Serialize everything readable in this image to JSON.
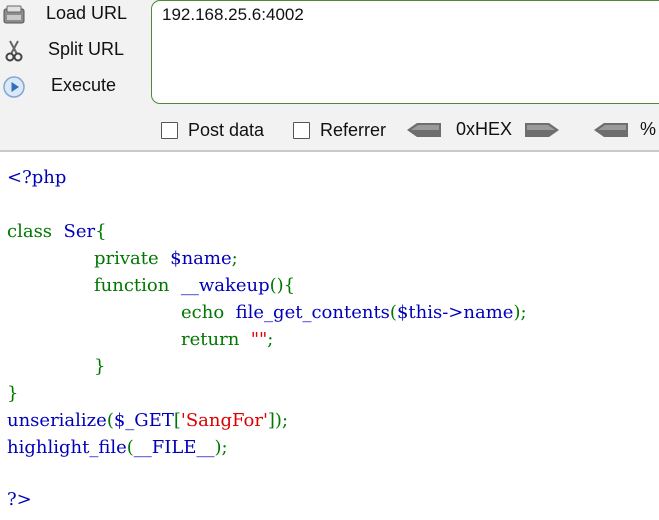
{
  "toolbar": {
    "load_url": "Load URL",
    "split_url": "Split URL",
    "execute": "Execute",
    "url_value": "192.168.25.6:4002",
    "post_data": "Post data",
    "referrer": "Referrer",
    "hex": "0xHEX",
    "percent": "%"
  },
  "source": {
    "open_tag": "<?php",
    "class_kw": "class",
    "class_name": "Ser",
    "brace_open": "{",
    "private_kw": "private",
    "prop_name": "$name",
    "semicolon": ";",
    "function_kw": "function",
    "method_name": "__wakeup",
    "paren_brace": "(){",
    "echo_kw": "echo",
    "fgc": "file_get_contents",
    "paren_open": "(",
    "this_name": "$this->name",
    "paren_close_semi": ");",
    "return_kw": "return",
    "empty_str": "\"\"",
    "brace_close": "}",
    "unserialize": "unserialize",
    "get_var": "$_GET",
    "bracket_open": "[",
    "key_str": "'SangFor'",
    "bracket_close_semi": "]);",
    "highlight": "highlight_file",
    "file_const": "__FILE__",
    "close_tag": "?>"
  }
}
